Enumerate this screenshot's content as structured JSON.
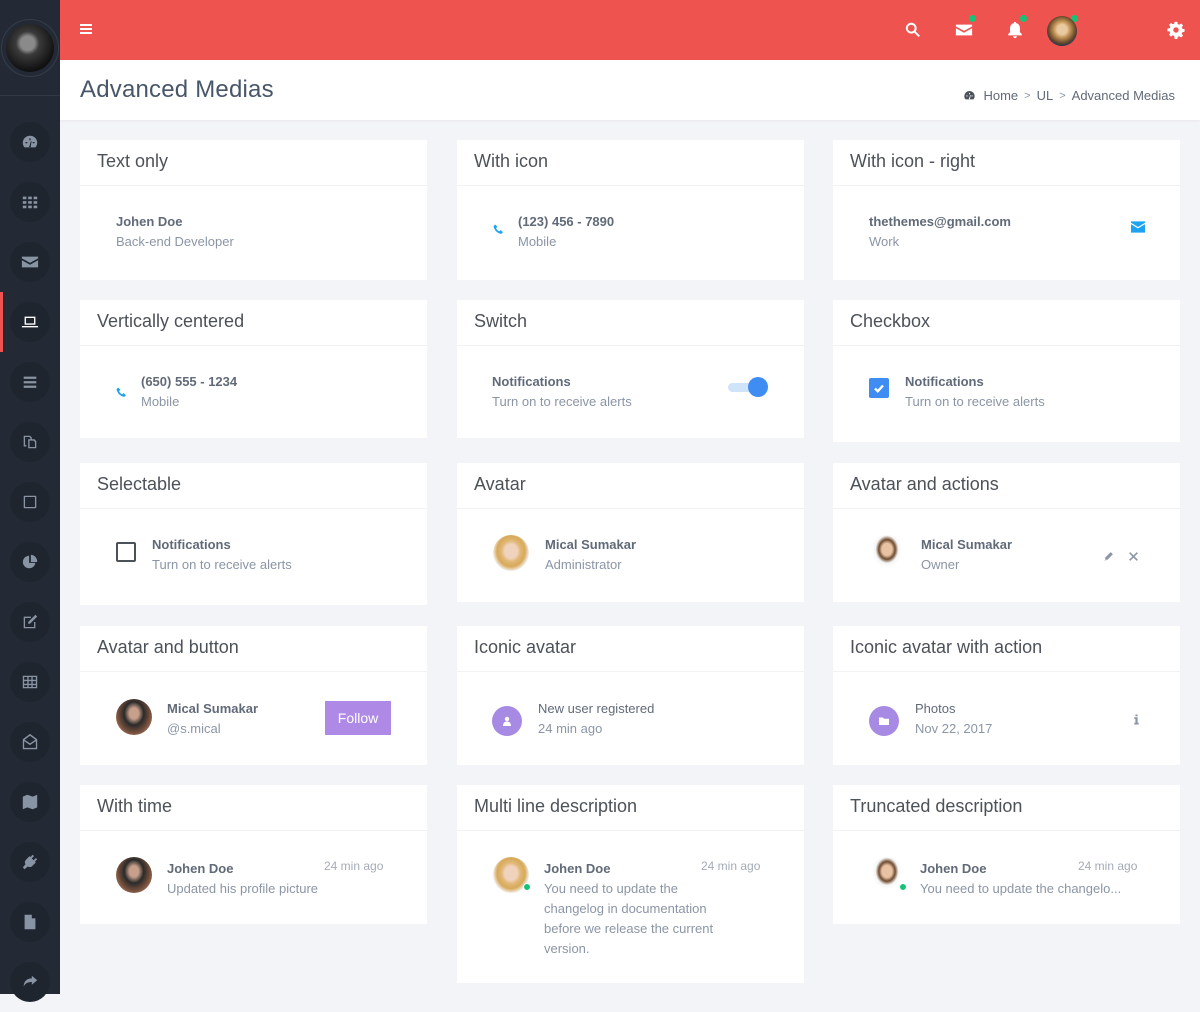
{
  "header": {
    "page_title": "Advanced Medias",
    "breadcrumb": [
      {
        "label": "Home",
        "icon": "dashboard-icon"
      },
      {
        "label": "UL"
      },
      {
        "label": "Advanced Medias"
      }
    ],
    "breadcrumb_separator": ">"
  },
  "topbar": {
    "icons": [
      "menu-icon",
      "search-icon",
      "mail-icon",
      "bell-icon",
      "chat-icon",
      "user-avatar",
      "gear-icon"
    ],
    "notification_dot_color": "#15c377",
    "background_color": "#ef5350"
  },
  "sidebar": {
    "items": [
      {
        "icon": "dashboard-icon"
      },
      {
        "icon": "grid-icon"
      },
      {
        "icon": "mail-icon"
      },
      {
        "icon": "laptop-icon",
        "active": true
      },
      {
        "icon": "list-icon"
      },
      {
        "icon": "copy-icon"
      },
      {
        "icon": "square-icon"
      },
      {
        "icon": "pie-chart-icon"
      },
      {
        "icon": "edit-icon"
      },
      {
        "icon": "table-icon"
      },
      {
        "icon": "envelope-open-icon"
      },
      {
        "icon": "map-icon"
      },
      {
        "icon": "plug-icon"
      },
      {
        "icon": "file-icon"
      },
      {
        "icon": "share-icon"
      }
    ],
    "active_color": "#ef5350"
  },
  "cards": {
    "text_only": {
      "title": "Text only",
      "name": "Johen Doe",
      "subtitle": "Back-end Developer"
    },
    "with_icon": {
      "title": "With icon",
      "name": "(123) 456 - 7890",
      "subtitle": "Mobile",
      "icon": "phone-icon"
    },
    "with_icon_right": {
      "title": "With icon - right",
      "name": "thethemes@gmail.com",
      "subtitle": "Work",
      "icon": "envelope-icon"
    },
    "vertically_centered": {
      "title": "Vertically centered",
      "name": "(650) 555 - 1234",
      "subtitle": "Mobile",
      "icon": "phone-icon"
    },
    "switch": {
      "title": "Switch",
      "name": "Notifications",
      "subtitle": "Turn on to receive alerts",
      "checked": true
    },
    "checkbox": {
      "title": "Checkbox",
      "name": "Notifications",
      "subtitle": "Turn on to receive alerts",
      "checked": true
    },
    "selectable": {
      "title": "Selectable",
      "name": "Notifications",
      "subtitle": "Turn on to receive alerts",
      "checked": false
    },
    "avatar": {
      "title": "Avatar",
      "name": "Mical Sumakar",
      "subtitle": "Administrator"
    },
    "avatar_actions": {
      "title": "Avatar and actions",
      "name": "Mical Sumakar",
      "subtitle": "Owner",
      "actions": [
        "edit-icon",
        "close-icon"
      ]
    },
    "avatar_button": {
      "title": "Avatar and button",
      "name": "Mical Sumakar",
      "subtitle": "@s.mical",
      "button": "Follow",
      "button_color": "#ae8ae6"
    },
    "iconic_avatar": {
      "title": "Iconic avatar",
      "name": "New user registered",
      "subtitle": "24 min ago",
      "icon": "user-icon"
    },
    "iconic_avatar_action": {
      "title": "Iconic avatar with action",
      "name": "Photos",
      "subtitle": "Nov 22, 2017",
      "icon": "folder-icon",
      "action": "info-icon"
    },
    "with_time": {
      "title": "With time",
      "name": "Johen Doe",
      "time": "24 min ago",
      "subtitle": "Updated his profile picture"
    },
    "multi_line": {
      "title": "Multi line description",
      "name": "Johen Doe",
      "time": "24 min ago",
      "lines": [
        "You need to update the",
        "changelog in documentation",
        "before we release the current",
        "version."
      ]
    },
    "truncated": {
      "title": "Truncated description",
      "name": "Johen Doe",
      "time": "24 min ago",
      "subtitle": "You need to update the changelo..."
    }
  }
}
